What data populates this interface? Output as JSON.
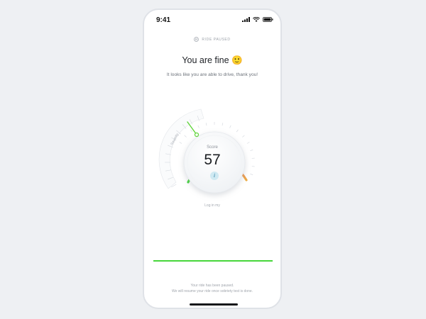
{
  "status_bar": {
    "time": "9:41",
    "icons": [
      "signal-icon",
      "wifi-icon",
      "battery-icon"
    ]
  },
  "ride_status": {
    "icon": "pause-circle-icon",
    "label": "RIDE PAUSED"
  },
  "title": "You are fine",
  "title_emoji": "🙂",
  "subtitle": "It looks like you are able to drive, thank you!",
  "gauge": {
    "severity_label": "Severity",
    "score_label": "Score",
    "score_value": "57",
    "info_icon": "info-icon",
    "info_glyph": "i",
    "colors": {
      "green": "#3fd43a",
      "yellow": "#e8c53a",
      "orange": "#ee9a4a",
      "red": "#ee6a6a"
    }
  },
  "log_link": "Log in my",
  "progress": {
    "fraction": 1.0,
    "color": "#46d63a"
  },
  "footer": {
    "line1": "Your ride has been paused.",
    "line2": "We will resume your ride once sobriety test is done."
  }
}
